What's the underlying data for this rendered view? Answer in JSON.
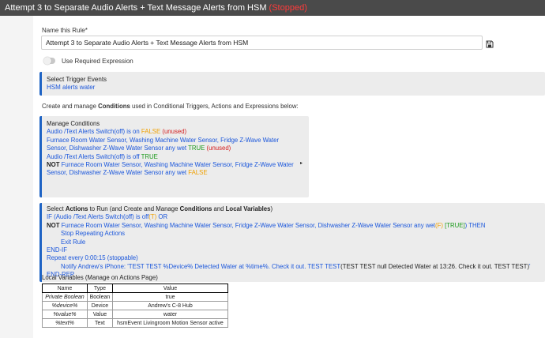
{
  "title": {
    "text": "Attempt 3 to Separate Audio Alerts + Text Message Alerts from HSM",
    "status": "(Stopped)"
  },
  "rule_name": {
    "label": "Name this Rule*",
    "value": "Attempt 3 to Separate Audio Alerts + Text Message Alerts from HSM"
  },
  "use_required_expression": {
    "label": "Use Required Expression",
    "enabled": false
  },
  "trigger": {
    "heading": "Select Trigger Events",
    "value": "HSM alerts water"
  },
  "conditions_intro": {
    "before": "Create and manage ",
    "bold": "Conditions",
    "after": " used in Conditional Triggers, Actions and Expressions below:"
  },
  "conditions": {
    "heading": "Manage Conditions",
    "c1_text": "Audio /Text Alerts Switch(off) is on ",
    "c1_state": "FALSE",
    "c1_unused": " (unused)",
    "c2_line1": "Furnace Room Water Sensor, Washing Machine Water Sensor, Fridge Z-Wave Water",
    "c2_line2": "Sensor, Dishwasher Z-Wave Water Sensor any wet ",
    "c2_state": "TRUE",
    "c2_unused": " (unused)",
    "c3_text": "Audio /Text Alerts Switch(off) is off ",
    "c3_state": "TRUE",
    "c4_not": "NOT",
    "c4_line1": " Furnace Room Water Sensor, Washing Machine Water Sensor, Fridge Z-Wave Water",
    "c4_line2": "Sensor, Dishwasher Z-Wave Water Sensor any wet ",
    "c4_state": "FALSE",
    "expand_arrow": "▸"
  },
  "actions": {
    "heading_pre": "Select ",
    "heading_b1": "Actions",
    "heading_mid": " to Run (and Create and Manage ",
    "heading_b2": "Conditions",
    "heading_mid2": " and ",
    "heading_b3": "Local Variables",
    "heading_end": ")",
    "l1_text": "IF (Audio /Text Alerts Switch(off) is off",
    "l1_state": "(T)",
    "l1_end": "  OR",
    "l2_not": "NOT",
    "l2_text": " Furnace Room Water Sensor, Washing Machine Water Sensor, Fridge Z-Wave Water Sensor, Dishwasher Z-Wave Water Sensor any wet",
    "l2_f": "(F)",
    "l2_true": "[TRUE]",
    "l2_end": ") THEN",
    "l3": "Stop Repeating Actions",
    "l4": "Exit Rule",
    "l5": "END-IF",
    "l6": "Repeat every 0:00:15 (stoppable)",
    "l7_blue": "Notify Andrew's iPhone: 'TEST TEST %Device% Detected Water at %time%.  Check it out.  TEST TEST",
    "l7_dark": "(TEST TEST null Detected Water at 13:26.  Check it out.  TEST TEST)",
    "l7_end": "'",
    "l8": "END-REP"
  },
  "local_variables": {
    "title": "Local Variables",
    "note": " (Manage on Actions Page)",
    "headers": [
      "Name",
      "Type",
      "Value"
    ],
    "rows": [
      [
        "Private Boolean",
        "Boolean",
        "true"
      ],
      [
        "%device%",
        "Device",
        "Andrew's C-8 Hub"
      ],
      [
        "%value%",
        "Value",
        "water"
      ],
      [
        "%text%",
        "Text",
        "hsmEvent Livingroom Motion Sensor active"
      ]
    ]
  },
  "colors": {
    "link_blue": "#1a56db",
    "false_orange": "#f0a000",
    "true_green": "#1b9a1b",
    "unused_red": "#d42020",
    "stopped_red": "#ff3b3b",
    "titlebar": "#4a4a4a",
    "panel_accent": "#1e63c4"
  },
  "icons": {
    "save": "floppy-disk-icon"
  }
}
